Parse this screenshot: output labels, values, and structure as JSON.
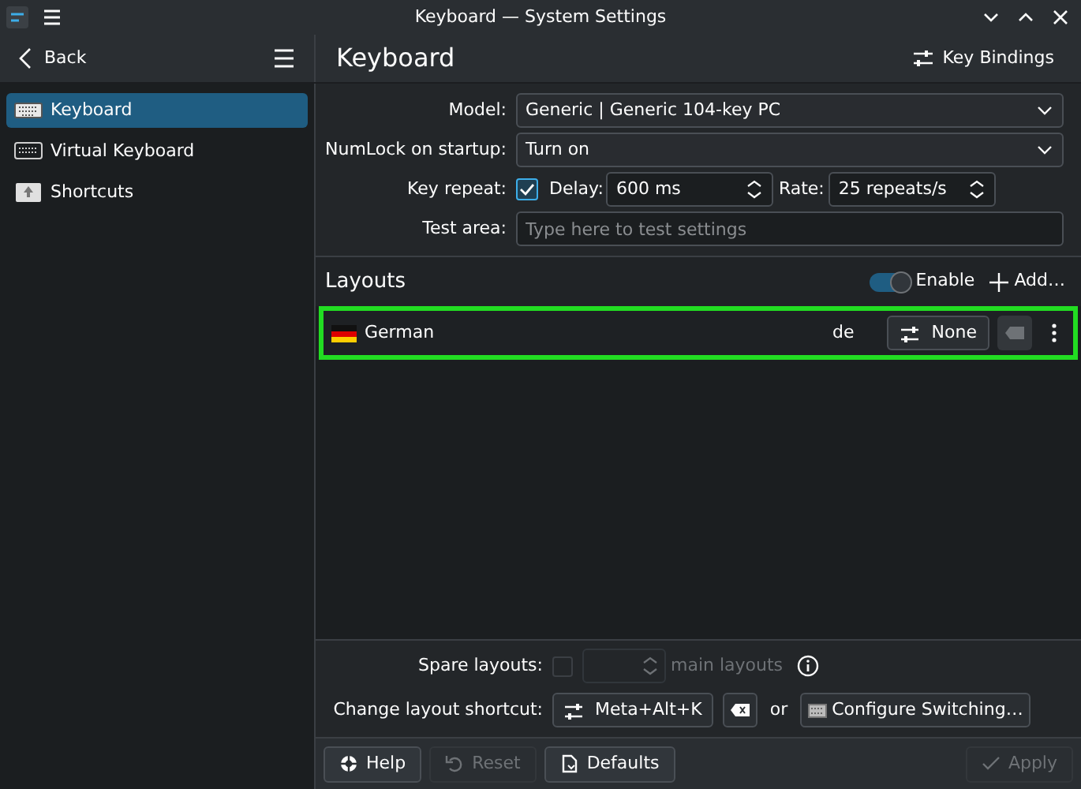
{
  "window": {
    "title": "Keyboard — System Settings"
  },
  "sidebar": {
    "back": "Back",
    "items": [
      {
        "label": "Keyboard",
        "kind": "keyboard",
        "selected": true
      },
      {
        "label": "Virtual Keyboard",
        "kind": "virtual",
        "selected": false
      },
      {
        "label": "Shortcuts",
        "kind": "shortcut",
        "selected": false
      }
    ]
  },
  "page": {
    "title": "Keyboard",
    "key_bindings": "Key Bindings"
  },
  "form": {
    "model": {
      "label": "Model:",
      "value": "Generic | Generic 104-key PC"
    },
    "numlock": {
      "label": "NumLock on startup:",
      "value": "Turn on"
    },
    "key_repeat": {
      "label": "Key repeat:",
      "checked": true,
      "delay_label": "Delay:",
      "delay": "600 ms",
      "rate_label": "Rate:",
      "rate": "25 repeats/s"
    },
    "test_area": {
      "label": "Test area:",
      "placeholder": "Type here to test settings"
    }
  },
  "layouts": {
    "title": "Layouts",
    "enable": {
      "label": "Enable",
      "on": true
    },
    "add": "Add…",
    "rows": [
      {
        "name": "German",
        "code": "de",
        "shortcut": "None",
        "selected": true
      }
    ]
  },
  "spare": {
    "label": "Spare layouts:",
    "checked": false,
    "suffix": "main layouts"
  },
  "shortcut": {
    "label": "Change layout shortcut:",
    "value": "Meta+Alt+K",
    "or": "or",
    "configure": "Configure Switching…"
  },
  "footer": {
    "buttons": [
      {
        "label": "Help",
        "kind": "help",
        "disabled": false
      },
      {
        "label": "Reset",
        "kind": "reset",
        "disabled": true
      },
      {
        "label": "Defaults",
        "kind": "defaults",
        "disabled": false
      },
      {
        "label": "Apply",
        "kind": "apply",
        "disabled": true
      }
    ]
  }
}
